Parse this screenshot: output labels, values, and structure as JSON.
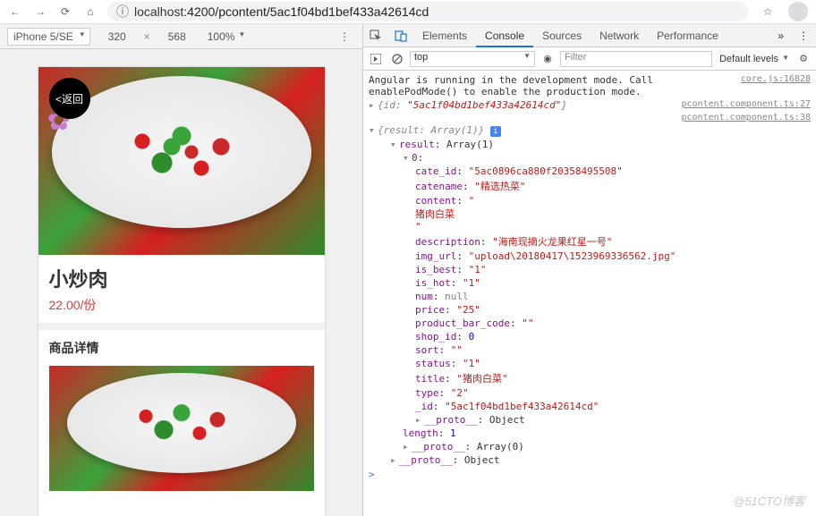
{
  "browser": {
    "url_host": "localhost",
    "url_path": ":4200/pcontent/5ac1f04bd1bef433a42614cd",
    "info_icon": "ⓘ"
  },
  "device_toolbar": {
    "device": "iPhone 5/SE",
    "width": "320",
    "height": "568",
    "zoom": "100%",
    "more": "⋮"
  },
  "page": {
    "back_label": "<返回",
    "dish_title": "小炒肉",
    "dish_price": "22.00/份",
    "detail_heading": "商品详情"
  },
  "devtools": {
    "tabs": [
      "Elements",
      "Console",
      "Sources",
      "Network",
      "Performance"
    ],
    "active_tab": "Console",
    "more": "»",
    "menu": "⋮",
    "context": "top",
    "filter_placeholder": "Filter",
    "levels": "Default levels",
    "msg_angular": "Angular is running in the development mode. Call enablePodMode() to enable the production mode.",
    "src_core": "core.js:16828",
    "src_pc27": "pcontent.component.ts:27",
    "src_pc38": "pcontent.component.ts:38",
    "id_log_prefix": "{id: ",
    "id_log_val": "\"5ac1f04bd1bef433a42614cd\"",
    "id_log_suffix": "}",
    "result_summary": "{result: Array(1)}",
    "result_label": "result",
    "result_type": ": Array(1)",
    "idx0": "0",
    "colon": ":",
    "obj_fields": [
      {
        "k": "cate_id",
        "v": "\"5ac0896ca880f20358495508\"",
        "t": "str"
      },
      {
        "k": "catename",
        "v": "\"精选热菜\"",
        "t": "str"
      },
      {
        "k": "content",
        "v": "\"<p>猪肉白菜</p>\"",
        "t": "str"
      },
      {
        "k": "description",
        "v": "\"海南现摘火龙果红星一号\"",
        "t": "str"
      },
      {
        "k": "img_url",
        "v": "\"upload\\20180417\\1523969336562.jpg\"",
        "t": "str"
      },
      {
        "k": "is_best",
        "v": "\"1\"",
        "t": "str"
      },
      {
        "k": "is_hot",
        "v": "\"1\"",
        "t": "str"
      },
      {
        "k": "num",
        "v": "null",
        "t": "null"
      },
      {
        "k": "price",
        "v": "\"25\"",
        "t": "str"
      },
      {
        "k": "product_bar_code",
        "v": "\"\"",
        "t": "str"
      },
      {
        "k": "shop_id",
        "v": "0",
        "t": "num"
      },
      {
        "k": "sort",
        "v": "\"\"",
        "t": "str"
      },
      {
        "k": "status",
        "v": "\"1\"",
        "t": "str"
      },
      {
        "k": "title",
        "v": "\"猪肉白菜\"",
        "t": "str"
      },
      {
        "k": "type",
        "v": "\"2\"",
        "t": "str"
      },
      {
        "k": "_id",
        "v": "\"5ac1f04bd1bef433a42614cd\"",
        "t": "str"
      }
    ],
    "proto_label": "__proto__",
    "proto_obj": ": Object",
    "length_label": "length",
    "length_val": "1",
    "proto_arr": ": Array(0)",
    "prompt": ">"
  },
  "watermark": "@51CTO博客"
}
